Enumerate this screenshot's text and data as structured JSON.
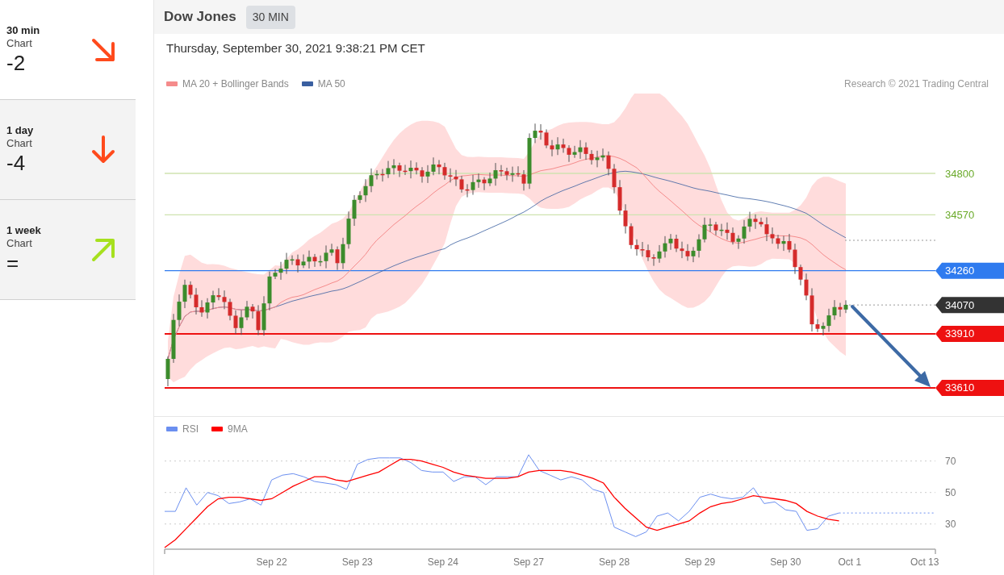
{
  "sidebar": {
    "items": [
      {
        "timeframe": "30 min",
        "label": "Chart",
        "score": "-2",
        "kind": "down-right",
        "color": "#ff4a1c",
        "selected": true
      },
      {
        "timeframe": "1 day",
        "label": "Chart",
        "score": "-4",
        "kind": "down",
        "color": "#ff4a1c",
        "selected": false
      },
      {
        "timeframe": "1 week",
        "label": "Chart",
        "score": "=",
        "kind": "up-right",
        "color": "#a6e01e",
        "selected": false
      }
    ]
  },
  "header": {
    "title": "Dow Jones",
    "interval": "30 MIN"
  },
  "timestamp": "Thursday, September 30, 2021 9:38:21 PM CET",
  "price_chart": {
    "legend": [
      {
        "label": "MA 20 + Bollinger Bands",
        "color": "#f58b8b"
      },
      {
        "label": "MA 50",
        "color": "#3a5fa0"
      }
    ],
    "credit": "Research © 2021 Trading Central",
    "levels": [
      {
        "label": "34800",
        "color": "#6aaa2a",
        "kind": "plain"
      },
      {
        "label": "34570",
        "color": "#6aaa2a",
        "kind": "plain"
      },
      {
        "label": "34260",
        "color": "#2f7bef",
        "kind": "badge"
      },
      {
        "label": "34070",
        "color": "#333333",
        "kind": "dotted"
      },
      {
        "label": "33910",
        "color": "#ee1111",
        "kind": "badge"
      },
      {
        "label": "33610",
        "color": "#ee1111",
        "kind": "badge"
      }
    ]
  },
  "rsi_chart": {
    "chart_data": {
      "type": "line",
      "categories": [
        null,
        null,
        null,
        null,
        null,
        null,
        null,
        null,
        null,
        null,
        "Sep 22",
        null,
        null,
        null,
        null,
        null,
        null,
        null,
        "Sep 23",
        null,
        null,
        null,
        null,
        null,
        null,
        null,
        "Sep 24",
        null,
        null,
        null,
        null,
        null,
        null,
        null,
        "Sep 27",
        null,
        null,
        null,
        null,
        null,
        null,
        null,
        "Sep 28",
        null,
        null,
        null,
        null,
        null,
        null,
        null,
        "Sep 29",
        null,
        null,
        null,
        null,
        null,
        null,
        null,
        "Sep 30",
        null,
        null,
        null,
        null,
        null,
        "Oct 1",
        null,
        null,
        null,
        null,
        null,
        null,
        "Oct 13",
        null
      ],
      "series": [
        {
          "name": "RSI",
          "color": "#6b8ff0",
          "values": [
            38,
            38,
            53,
            42,
            50,
            48,
            43,
            44,
            46,
            42,
            58,
            61,
            62,
            60,
            57,
            56,
            55,
            52,
            68,
            71,
            72,
            72,
            72,
            69,
            64,
            63,
            63,
            57,
            60,
            60,
            55,
            60,
            60,
            60,
            74,
            64,
            61,
            58,
            60,
            58,
            52,
            50,
            28,
            25,
            22,
            25,
            35,
            37,
            32,
            38,
            47,
            49,
            47,
            46,
            47,
            53,
            43,
            44,
            39,
            38,
            26,
            27,
            35,
            37,
            null,
            null,
            null,
            null,
            null,
            null,
            null,
            null,
            null
          ]
        },
        {
          "name": "9MA",
          "color": "#ff0000",
          "values": [
            15,
            20,
            27,
            34,
            41,
            46,
            47,
            47,
            46,
            45,
            46,
            50,
            54,
            57,
            60,
            60,
            58,
            57,
            59,
            61,
            63,
            67,
            71,
            71,
            70,
            68,
            66,
            63,
            61,
            60,
            59,
            59,
            59,
            60,
            63,
            64,
            64,
            64,
            63,
            61,
            59,
            56,
            47,
            40,
            34,
            28,
            26,
            28,
            30,
            32,
            37,
            41,
            43,
            44,
            46,
            48,
            47,
            46,
            45,
            43,
            38,
            35,
            33,
            32,
            null,
            null,
            null,
            null,
            null,
            null,
            null,
            null,
            null
          ]
        }
      ],
      "yticks": [
        30,
        50,
        70
      ],
      "ylim": [
        14,
        98
      ],
      "grid": true,
      "legend": "top-left"
    }
  }
}
